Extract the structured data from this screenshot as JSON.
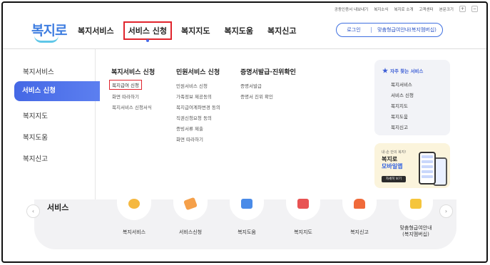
{
  "util_links": [
    "공동인증서 내보내기",
    "복지소식",
    "복지로 소개",
    "고객센터",
    "본문크기"
  ],
  "util_plus": "+",
  "util_minus": "−",
  "logo": "복지로",
  "gnb": [
    "복지서비스",
    "서비스 신청",
    "복지지도",
    "복지도움",
    "복지신고"
  ],
  "header_buttons": {
    "login": "로그인",
    "custom": "맞춤형급여안내(복지멤버십)"
  },
  "lnb": [
    "복지서비스",
    "서비스 신청",
    "복지지도",
    "복지도움",
    "복지신고"
  ],
  "columns": [
    {
      "title": "복지서비스 신청",
      "links": [
        "복지급여 신청",
        "화면 따라하기",
        "복지서비스 신청서식"
      ]
    },
    {
      "title": "민원서비스 신청",
      "links": [
        "민원서비스 신청",
        "가족정보 제공동의",
        "복지급여계좌변경 동의",
        "직권신청요청 동의",
        "증빙서류 제출",
        "화면 따라하기"
      ]
    },
    {
      "title": "증명서발급·진위확인",
      "links": [
        "증명서발급",
        "증명서 진위 확인"
      ]
    }
  ],
  "favorites": {
    "title": "자주 찾는 서비스",
    "items": [
      "복지서비스",
      "서비스 신청",
      "복지지도",
      "복지도움",
      "복지신고"
    ]
  },
  "app_banner": {
    "small": "내·손 안의 복지!",
    "line1": "복지로",
    "line2": "모바일앱",
    "button": "자세히 보기"
  },
  "service_section": {
    "title": "서비스",
    "prev": "‹",
    "next": "›",
    "items": [
      "복지서비스",
      "서비스신청",
      "복지도움",
      "복지지도",
      "복지신고",
      "맞춤형급여안내\n(복지멤버십)"
    ]
  },
  "colors": {
    "primary": "#4568e5",
    "highlight": "#e0242d",
    "panel": "#f2f3f7",
    "banner": "#fbf4dc"
  }
}
